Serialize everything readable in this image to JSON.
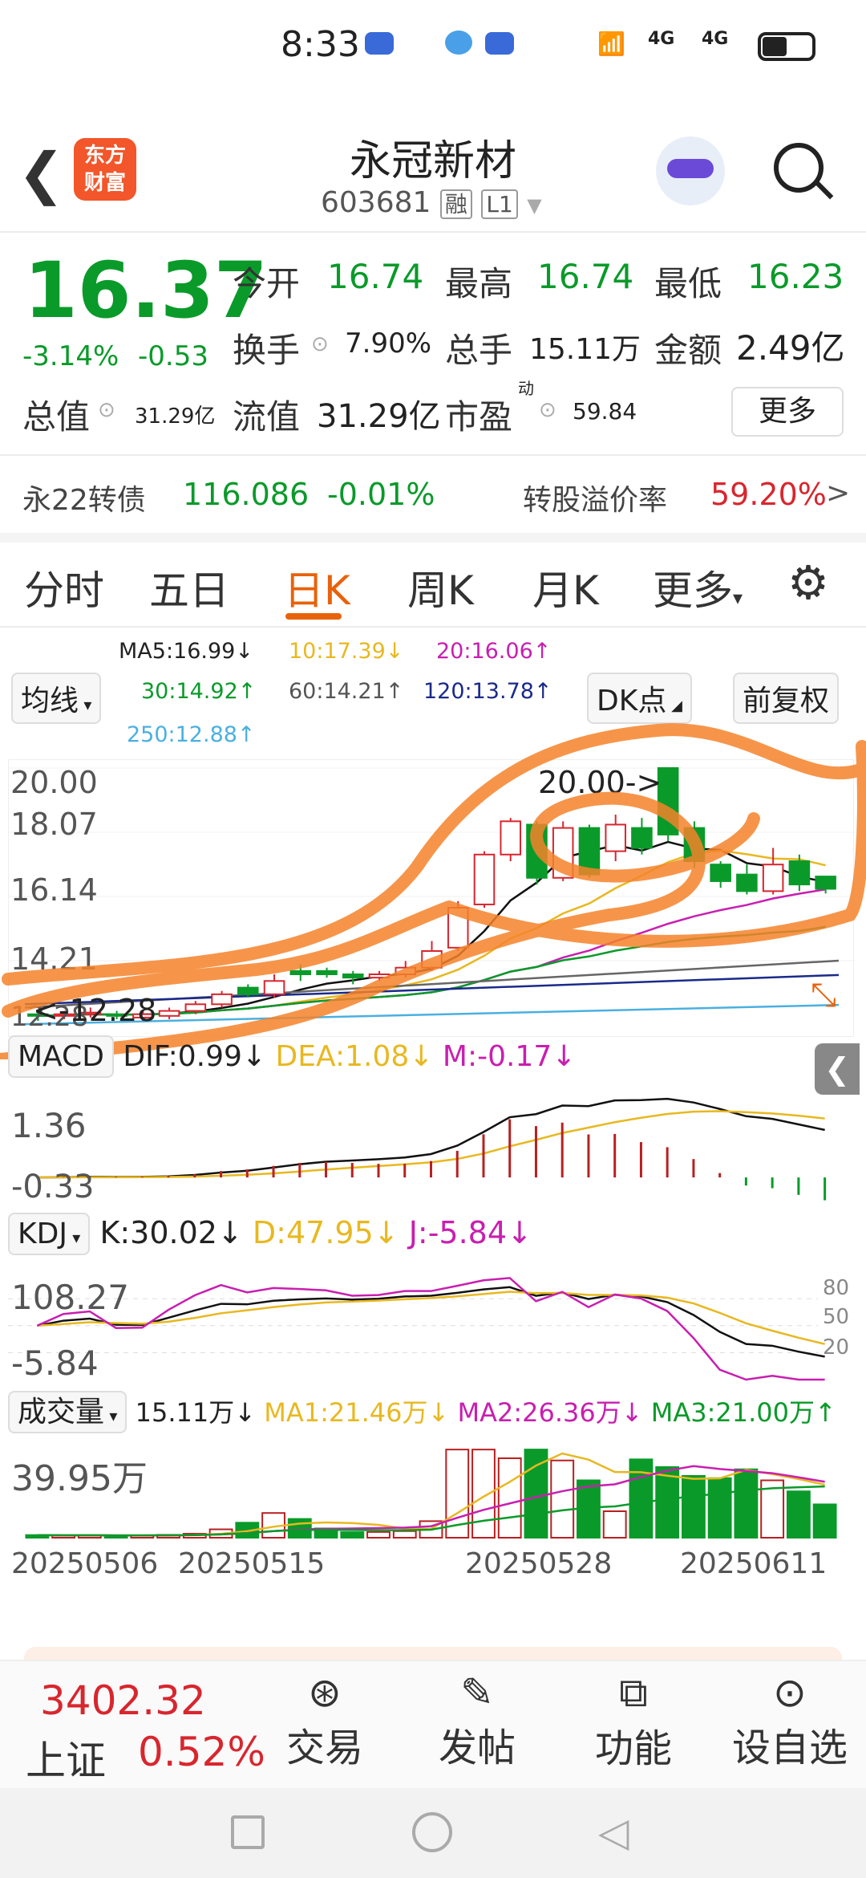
{
  "status": {
    "time": "8:33",
    "net1": "4G",
    "net2": "4G"
  },
  "header": {
    "title": "永冠新材",
    "code": "603681",
    "tag1": "融",
    "tag2": "L1",
    "logo_line1": "东方",
    "logo_line2": "财富"
  },
  "quote": {
    "price": "16.37",
    "pct": "-3.14%",
    "chg": "-0.53",
    "open_label": "今开",
    "open": "16.74",
    "high_label": "最高",
    "high": "16.74",
    "low_label": "最低",
    "low": "16.23",
    "turnover_label": "换手",
    "turnover": "7.90%",
    "volume_label": "总手",
    "volume": "15.11万",
    "amount_label": "金额",
    "amount": "2.49亿",
    "mktcap_label": "总值",
    "mktcap": "31.29亿",
    "float_label": "流值",
    "float": "31.29亿",
    "pe_label": "市盈",
    "pe_sup": "动",
    "pe": "59.84",
    "more": "更多"
  },
  "bond": {
    "name": "永22转债",
    "price": "116.086",
    "pct": "-0.01%",
    "premium_label": "转股溢价率",
    "premium": "59.20%",
    "arrow": ">"
  },
  "tabs": [
    "分时",
    "五日",
    "日K",
    "周K",
    "月K",
    "更多"
  ],
  "ma": {
    "selector": "均线",
    "ma5": "MA5:16.99↓",
    "ma10": "10:17.39↓",
    "ma20": "20:16.06↑",
    "ma30": "30:14.92↑",
    "ma60": "60:14.21↑",
    "ma120": "120:13.78↑",
    "ma250": "250:12.88↑",
    "dk": "DK点",
    "adjust": "前复权",
    "colors": {
      "ma5": "#111111",
      "ma10": "#e8b820",
      "ma20": "#c81fb0",
      "ma30": "#0a9a2a",
      "ma60": "#666666",
      "ma120": "#1a2a8a",
      "ma250": "#4ab0e0"
    }
  },
  "kchart": {
    "y_labels": [
      "20.00",
      "18.07",
      "16.14",
      "14.21",
      "12.28"
    ],
    "high_note": "20.00->",
    "low_note": "<-12.28"
  },
  "macd": {
    "name": "MACD",
    "dif": "DIF:0.99↓",
    "dea": "DEA:1.08↓",
    "m": "M:-0.17↓",
    "y_top": "1.36",
    "y_bottom": "-0.33"
  },
  "kdj": {
    "name": "KDJ",
    "k": "K:30.02↓",
    "d": "D:47.95↓",
    "j": "J:-5.84↓",
    "y_top": "108.27",
    "y_bottom": "-5.84",
    "r80": "80",
    "r50": "50",
    "r20": "20"
  },
  "vol": {
    "name": "成交量",
    "v": "15.11万↓",
    "ma1": "MA1:21.46万↓",
    "ma2": "MA2:26.36万↓",
    "ma3": "MA3:21.00万↑",
    "y_top": "39.95万"
  },
  "dates": [
    "20250506",
    "20250515",
    "20250528",
    "20250611"
  ],
  "bottom": {
    "index_value": "3402.32",
    "index_name": "上证",
    "index_pct": "0.52%",
    "trade": "交易",
    "post": "发帖",
    "func": "功能",
    "watch": "设自选"
  },
  "chart_data": {
    "type": "candlestick",
    "note": "Daily K-line of 永冠新材 (603681), 前复权",
    "x_range": [
      "20250506",
      "20250613"
    ],
    "ylim": [
      12.28,
      20.0
    ],
    "candles": [
      {
        "o": 12.6,
        "c": 12.55,
        "h": 12.7,
        "l": 12.4
      },
      {
        "o": 12.55,
        "c": 12.6,
        "h": 12.7,
        "l": 12.45
      },
      {
        "o": 12.6,
        "c": 12.65,
        "h": 12.8,
        "l": 12.5
      },
      {
        "o": 12.6,
        "c": 12.55,
        "h": 12.7,
        "l": 12.45
      },
      {
        "o": 12.5,
        "c": 12.6,
        "h": 12.7,
        "l": 12.4
      },
      {
        "o": 12.55,
        "c": 12.7,
        "h": 12.8,
        "l": 12.45
      },
      {
        "o": 12.7,
        "c": 12.9,
        "h": 13.0,
        "l": 12.6
      },
      {
        "o": 12.9,
        "c": 13.2,
        "h": 13.3,
        "l": 12.8
      },
      {
        "o": 13.4,
        "c": 13.2,
        "h": 13.5,
        "l": 13.1
      },
      {
        "o": 13.2,
        "c": 13.6,
        "h": 13.8,
        "l": 13.1
      },
      {
        "o": 13.9,
        "c": 13.8,
        "h": 14.1,
        "l": 13.6
      },
      {
        "o": 13.9,
        "c": 13.8,
        "h": 14.0,
        "l": 13.7
      },
      {
        "o": 13.8,
        "c": 13.7,
        "h": 13.9,
        "l": 13.5
      },
      {
        "o": 13.7,
        "c": 13.8,
        "h": 13.9,
        "l": 13.6
      },
      {
        "o": 13.8,
        "c": 14.0,
        "h": 14.2,
        "l": 13.7
      },
      {
        "o": 14.0,
        "c": 14.5,
        "h": 14.8,
        "l": 13.9
      },
      {
        "o": 14.6,
        "c": 15.8,
        "h": 16.0,
        "l": 14.5
      },
      {
        "o": 15.9,
        "c": 17.4,
        "h": 17.5,
        "l": 15.8
      },
      {
        "o": 17.4,
        "c": 18.4,
        "h": 18.5,
        "l": 17.2
      },
      {
        "o": 18.3,
        "c": 16.7,
        "h": 18.4,
        "l": 16.5
      },
      {
        "o": 16.7,
        "c": 18.2,
        "h": 18.4,
        "l": 16.6
      },
      {
        "o": 18.2,
        "c": 16.8,
        "h": 18.3,
        "l": 16.7
      },
      {
        "o": 17.5,
        "c": 18.3,
        "h": 18.6,
        "l": 17.2
      },
      {
        "o": 18.2,
        "c": 17.6,
        "h": 18.5,
        "l": 17.4
      },
      {
        "o": 20.0,
        "c": 18.0,
        "h": 20.0,
        "l": 17.8
      },
      {
        "o": 18.2,
        "c": 17.2,
        "h": 18.4,
        "l": 17.0
      },
      {
        "o": 17.1,
        "c": 16.6,
        "h": 17.2,
        "l": 16.4
      },
      {
        "o": 16.8,
        "c": 16.3,
        "h": 17.1,
        "l": 16.2
      },
      {
        "o": 16.3,
        "c": 17.1,
        "h": 17.6,
        "l": 16.2
      },
      {
        "o": 17.2,
        "c": 16.5,
        "h": 17.4,
        "l": 16.3
      },
      {
        "o": 16.74,
        "c": 16.37,
        "h": 16.74,
        "l": 16.23
      }
    ],
    "volumes": [
      1.2,
      1.0,
      1.1,
      0.9,
      1.0,
      1.3,
      1.8,
      3.8,
      6.8,
      11.2,
      8.5,
      4.2,
      2.5,
      2.6,
      3.0,
      7.5,
      39.95,
      39.95,
      36.0,
      39.95,
      35.0,
      26.0,
      12.0,
      35.5,
      32.0,
      28.0,
      27.0,
      31.0,
      26.0,
      21.0,
      15.11
    ]
  }
}
